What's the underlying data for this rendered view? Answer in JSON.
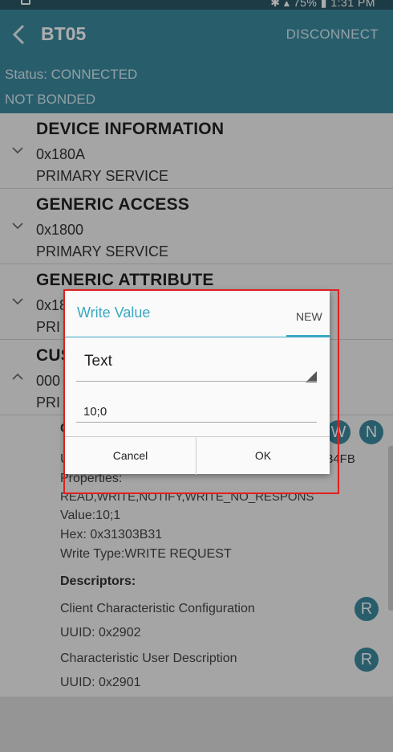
{
  "status_bar": {
    "battery": "75%",
    "time": "1:31 PM"
  },
  "app_bar": {
    "title": "BT05",
    "disconnect_label": "DISCONNECT"
  },
  "connection": {
    "status": "Status: CONNECTED",
    "bond": "NOT BONDED"
  },
  "services": [
    {
      "name": "DEVICE INFORMATION",
      "uuid": "0x180A",
      "type": "PRIMARY SERVICE"
    },
    {
      "name": "GENERIC ACCESS",
      "uuid": "0x1800",
      "type": "PRIMARY SERVICE"
    },
    {
      "name": "GENERIC ATTRIBUTE",
      "uuid": "0x18",
      "type": "PRI"
    },
    {
      "name": "CUS",
      "uuid": "000",
      "type": "PRI"
    }
  ],
  "characteristic": {
    "name_partial": "C",
    "uuid_partial": "U",
    "uuid_tail": "34FB",
    "properties_label": "Properties:",
    "properties": "READ,WRITE,NOTIFY,WRITE_NO_RESPONS",
    "value": "Value:10;1",
    "hex": "Hex: 0x31303B31",
    "write_type": "Write Type:WRITE REQUEST",
    "badge_w": "W",
    "badge_n": "N"
  },
  "descriptors": {
    "header": "Descriptors:",
    "items": [
      {
        "name": "Client Characteristic Configuration",
        "uuid": "UUID: 0x2902",
        "badge": "R"
      },
      {
        "name": "Characteristic User Description",
        "uuid": "UUID: 0x2901",
        "badge": "R"
      }
    ]
  },
  "dialog": {
    "title": "Write Value",
    "tab_new": "NEW",
    "format_selected": "Text",
    "input_value": "10;0",
    "cancel_label": "Cancel",
    "ok_label": "OK"
  },
  "colors": {
    "accent": "#3aa7c2",
    "app_bar": "#3b8aa0",
    "highlight_box": "#e02020"
  }
}
